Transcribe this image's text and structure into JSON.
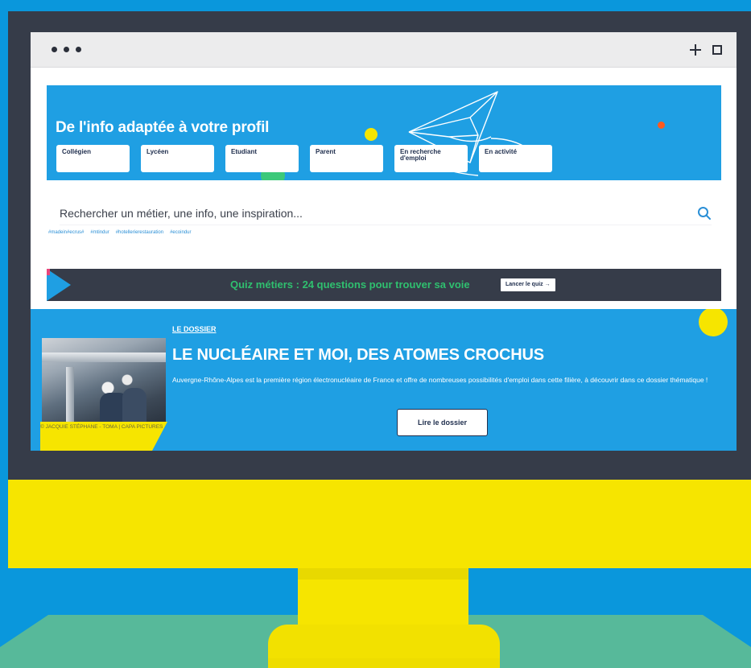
{
  "profile": {
    "title": "De l'info adaptée à votre profil",
    "options": [
      "Collégien",
      "Lycéen",
      "Etudiant",
      "Parent",
      "En recherche d'emploi",
      "En activité"
    ]
  },
  "search": {
    "placeholder": "Rechercher un métier, une info, une inspiration...",
    "tags": [
      "#madein#ecrus#",
      "#mtindur",
      "#hotellerierestauration",
      "#ecoindur"
    ]
  },
  "quiz": {
    "text": "Quiz métiers : 24 questions pour trouver sa voie",
    "button": "Lancer le quiz →"
  },
  "dossier": {
    "kicker": "LE DOSSIER",
    "title": "LE NUCLÉAIRE ET MOI, DES ATOMES CROCHUS",
    "description": "Auvergne-Rhône-Alpes est la première région électronucléaire de France et offre de nombreuses possibilités d'emploi dans cette filière, à découvrir dans ce dossier thématique !",
    "button": "Lire le dossier",
    "photo_credit": "© JACQUIE STÉPHANE - TOMA | CAPA PICTURES"
  },
  "colors": {
    "frame_blue": "#0a97dc",
    "bezel": "#363c49",
    "monitor_yellow": "#f6e500",
    "desk_green": "#57b99a",
    "banner_blue": "#1f9fe3",
    "quiz_green": "#2fc06f"
  },
  "icons": {
    "window_menu": "three-dots-icon",
    "new_tab": "plus-icon",
    "maximize": "square-icon",
    "search": "search-icon",
    "decoration": "paper-plane-icon"
  }
}
